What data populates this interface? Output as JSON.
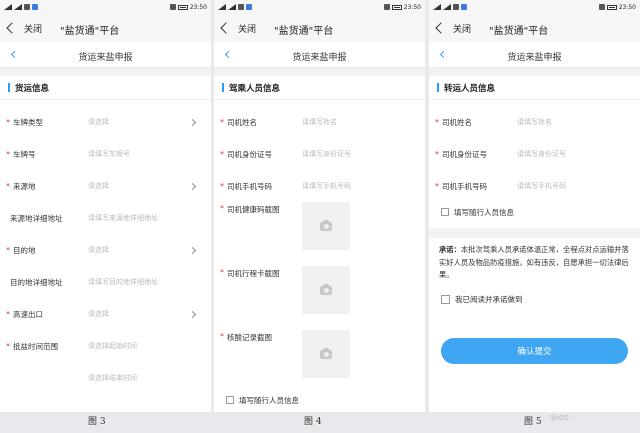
{
  "status": {
    "time": "23:50",
    "battery": "88"
  },
  "phones": [
    {
      "close": "关闭",
      "app_title": "\"盐货通\"平台",
      "page_title": "货运来盐申报",
      "section": "货运信息",
      "rows": [
        {
          "label": "车牌类型",
          "value": "请选择"
        },
        {
          "label": "车牌号",
          "value": "请填写车牌号"
        },
        {
          "label": "来源地",
          "value": "请选择"
        },
        {
          "label": "来源地详细地址",
          "value": "请填写来源地详细地址"
        },
        {
          "label": "目的地",
          "value": "请选择"
        },
        {
          "label": "目的地详细地址",
          "value": "请填写目的地详细地址"
        },
        {
          "label": "高速出口",
          "value": "请选择"
        },
        {
          "label": "抵盐时间范围",
          "value": "请选择起始时间",
          "value2": "请选择结束时间"
        }
      ]
    },
    {
      "close": "关闭",
      "app_title": "\"盐货通\"平台",
      "page_title": "货运来盐申报",
      "section": "驾乘人员信息",
      "rows": [
        {
          "label": "司机姓名",
          "value": "请填写姓名"
        },
        {
          "label": "司机身份证号",
          "value": "请填写身份证号"
        },
        {
          "label": "司机手机号码",
          "value": "请填写手机号码"
        }
      ],
      "images": [
        {
          "label": "司机健康码截图"
        },
        {
          "label": "司机行程卡截图"
        },
        {
          "label": "核酸记录截图"
        }
      ],
      "companion": "填写随行人员信息"
    },
    {
      "close": "关闭",
      "app_title": "\"盐货通\"平台",
      "page_title": "货运来盐申报",
      "section": "转运人员信息",
      "rows": [
        {
          "label": "司机姓名",
          "value": "请填写姓名"
        },
        {
          "label": "司机身份证号",
          "value": "请填写身份证号"
        },
        {
          "label": "司机手机号码",
          "value": "请填写手机号码"
        }
      ],
      "companion": "填写随行人员信息",
      "pledge_title": "承诺：",
      "pledge_text": "本批次驾乘人员承诺体温正常，全程点对点运输并落实好人员及物品防疫措施，如有违反，自愿承担一切法律后果。",
      "agree": "我已阅读并承诺做到",
      "submit": "确认提交"
    }
  ],
  "captions": [
    "图 3",
    "图 4",
    "图 5"
  ],
  "watermark": "@iOS"
}
